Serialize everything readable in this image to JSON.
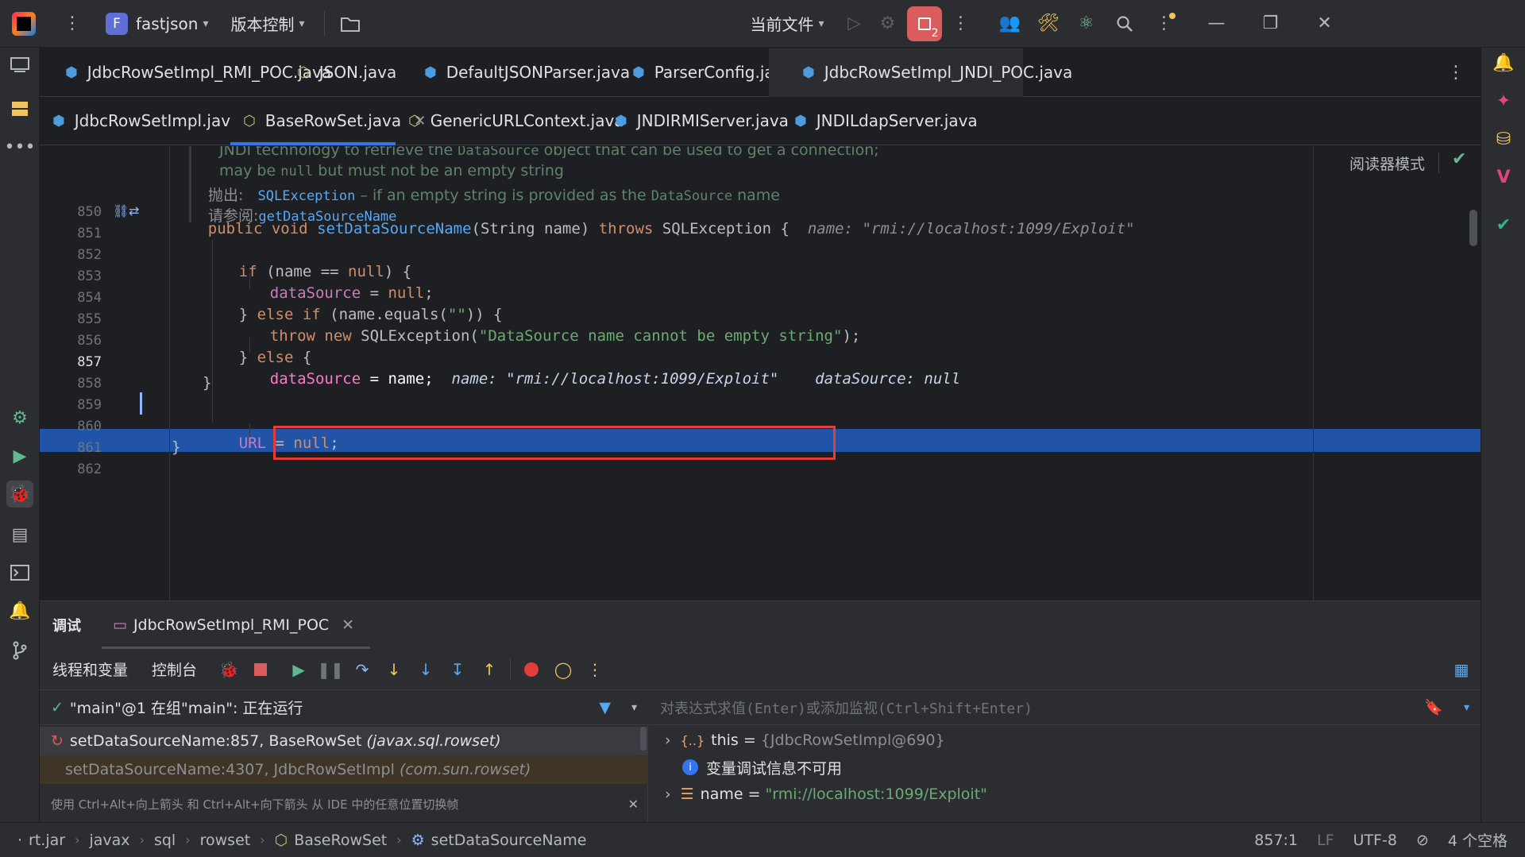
{
  "titlebar": {
    "project_initial": "F",
    "project_name": "fastjson",
    "vcs_label": "版本控制",
    "run_config": "当前文件",
    "stop_badge": "2"
  },
  "tabs_row1": [
    {
      "label": "JdbcRowSetImpl_RMI_POC.java",
      "icon": "java-class-icon"
    },
    {
      "label": "JSON.java",
      "icon": "java-class-icon"
    },
    {
      "label": "DefaultJSONParser.java",
      "icon": "java-class-icon"
    },
    {
      "label": "ParserConfig.java",
      "icon": "java-class-icon"
    },
    {
      "label": "JdbcRowSetImpl_JNDI_POC.java",
      "icon": "java-class-icon"
    }
  ],
  "tabs_row2": [
    {
      "label": "JdbcRowSetImpl.java",
      "icon": "java-class-icon"
    },
    {
      "label": "BaseRowSet.java",
      "icon": "java-class-icon",
      "active": true
    },
    {
      "label": "GenericURLContext.java",
      "icon": "java-class-icon"
    },
    {
      "label": "JNDIRMIServer.java",
      "icon": "java-class-icon"
    },
    {
      "label": "JNDILdapServer.java",
      "icon": "java-class-icon"
    }
  ],
  "editor": {
    "reader_mode": "阅读器模式",
    "doc": {
      "line1_pre": "JNDI technology to retrieve the ",
      "line1_code": "DataSource",
      "line1_post": " object that can be used to get a connection;",
      "line2_pre": "may be ",
      "line2_code": "null",
      "line2_post": " but must not be an empty string",
      "throws_label": "抛出:",
      "throws_link": "SQLException",
      "throws_text_pre": " – if an empty string is provided as the ",
      "throws_code": "DataSource",
      "throws_text_post": " name",
      "see_label": "请参阅:",
      "see_link": "getDataSourceName"
    },
    "line_numbers": [
      "850",
      "851",
      "852",
      "853",
      "854",
      "855",
      "856",
      "857",
      "858",
      "859",
      "860",
      "861",
      "862"
    ],
    "hints": {
      "l850": "name: \"rmi://localhost:1099/Exploit\"",
      "l857_name": "name: \"rmi://localhost:1099/Exploit\"",
      "l857_ds": "dataSource: null"
    }
  },
  "debug": {
    "title": "调试",
    "session_tab": "JdbcRowSetImpl_RMI_POC",
    "tab_threads": "线程和变量",
    "tab_console": "控制台",
    "thread_status": "\"main\"@1 在组\"main\": 正在运行",
    "frames": [
      {
        "method": "setDataSourceName:857, BaseRowSet",
        "pkg": "(javax.sql.rowset)"
      },
      {
        "method": "setDataSourceName:4307, JdbcRowSetImpl",
        "pkg": "(com.sun.rowset)"
      }
    ],
    "frame_tip": "使用 Ctrl+Alt+向上箭头 和 Ctrl+Alt+向下箭头 从 IDE 中的任意位置切换帧",
    "eval_placeholder": "对表达式求值(Enter)或添加监视(Ctrl+Shift+Enter)",
    "vars": [
      {
        "name": "this",
        "eq": " = ",
        "value": "{JdbcRowSetImpl@690}"
      },
      {
        "name": "",
        "eq": "",
        "value": "变量调试信息不可用"
      },
      {
        "name": "name",
        "eq": " = ",
        "value": "\"rmi://localhost:1099/Exploit\""
      }
    ]
  },
  "statusbar": {
    "crumbs": [
      "rt.jar",
      "javax",
      "sql",
      "rowset",
      "BaseRowSet",
      "setDataSourceName"
    ],
    "position": "857:1",
    "line_sep": "LF",
    "encoding": "UTF-8",
    "indent": "4 个空格"
  },
  "colors": {
    "accent": "#3574f0",
    "exec_line": "#2154a7",
    "highlight_box": "#e23c3c"
  }
}
